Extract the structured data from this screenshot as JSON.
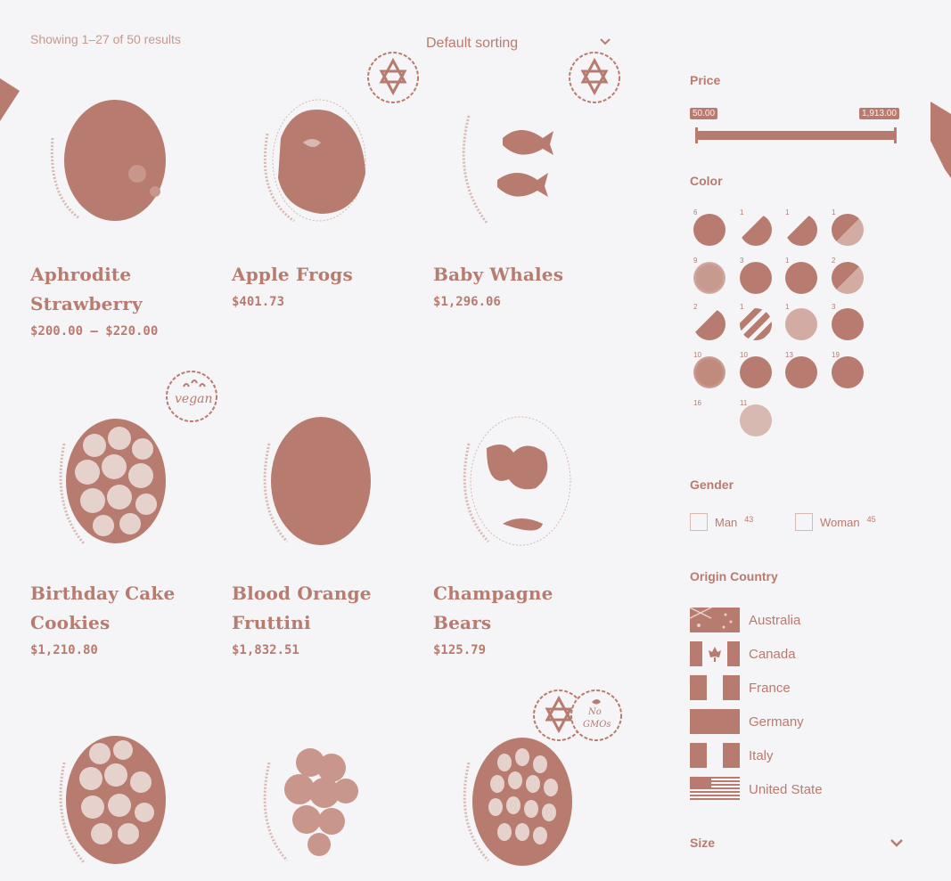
{
  "toolbar": {
    "result_count": "Showing 1–27 of 50 results",
    "sorting_label": "Default sorting"
  },
  "products": [
    {
      "title": "Aphrodite Strawberry",
      "price": "$200.00 – $220.00",
      "image": "chocolate-egg"
    },
    {
      "title": "Apple Frogs",
      "price": "$401.73",
      "image": "jelly-frogs-egg",
      "badges": [
        "kosher"
      ]
    },
    {
      "title": "Baby Whales",
      "price": "$1,296.06",
      "image": "whale-gummies-egg",
      "badges": [
        "kosher"
      ]
    },
    {
      "title": "Birthday Cake Cookies",
      "price": "$1,210.80",
      "image": "round-cookies-egg",
      "badges": [
        "vegan"
      ]
    },
    {
      "title": "Blood Orange Fruttini",
      "price": "$1,832.51",
      "image": "orange-fruttini-egg"
    },
    {
      "title": "Champagne Bears",
      "price": "$125.79",
      "image": "bears-egg"
    },
    {
      "title": "",
      "price": "",
      "image": "cookie-balls-egg"
    },
    {
      "title": "",
      "price": "",
      "image": "gummy-cluster-egg"
    },
    {
      "title": "",
      "price": "",
      "image": "dragee-egg",
      "badges": [
        "kosher",
        "no-gmo"
      ]
    }
  ],
  "badge_text": {
    "vegan": "vegan",
    "no_gmo_line1": "No",
    "no_gmo_line2": "GMOs"
  },
  "sidebar": {
    "price": {
      "title": "Price",
      "min_label": "50.00",
      "max_label": "1,913.00"
    },
    "color": {
      "title": "Color",
      "swatches": [
        {
          "count": "6",
          "color": "#b77c6f",
          "style": "solid"
        },
        {
          "count": "1",
          "color": "#b77c6f",
          "style": "half"
        },
        {
          "count": "1",
          "color": "#b77c6f",
          "style": "half"
        },
        {
          "count": "1",
          "color": "#b77c6f",
          "style": "split"
        },
        {
          "count": "9",
          "color": "#c79a8f",
          "style": "dotted"
        },
        {
          "count": "3",
          "color": "#b77c6f",
          "style": "solid"
        },
        {
          "count": "1",
          "color": "#b77c6f",
          "style": "solid"
        },
        {
          "count": "2",
          "color": "#b77c6f",
          "style": "split"
        },
        {
          "count": "2",
          "color": "#b77c6f",
          "style": "half"
        },
        {
          "count": "1",
          "color": "#b77c6f",
          "style": "stripes"
        },
        {
          "count": "1",
          "color": "#d2aba2",
          "style": "light"
        },
        {
          "count": "3",
          "color": "#b77c6f",
          "style": "solid"
        },
        {
          "count": "10",
          "color": "#c08a7d",
          "style": "dotted"
        },
        {
          "count": "10",
          "color": "#b77c6f",
          "style": "solid"
        },
        {
          "count": "13",
          "color": "#b77c6f",
          "style": "solid"
        },
        {
          "count": "19",
          "color": "#b77c6f",
          "style": "solid"
        },
        {
          "count": "16",
          "color": "#f5f4f6",
          "style": "empty"
        },
        {
          "count": "11",
          "color": "#d8b9b2",
          "style": "light"
        }
      ]
    },
    "gender": {
      "title": "Gender",
      "options": [
        {
          "label": "Man",
          "count": "43"
        },
        {
          "label": "Woman",
          "count": "45"
        }
      ]
    },
    "origin": {
      "title": "Origin Country",
      "countries": [
        {
          "name": "Australia",
          "flag": "australia"
        },
        {
          "name": "Canada",
          "flag": "canada"
        },
        {
          "name": "France",
          "flag": "france"
        },
        {
          "name": "Germany",
          "flag": "germany"
        },
        {
          "name": "Italy",
          "flag": "italy"
        },
        {
          "name": "United State",
          "flag": "usa"
        }
      ]
    },
    "size": {
      "title": "Size"
    }
  },
  "colors": {
    "accent": "#b77c6f",
    "background": "#f5f4f6",
    "muted": "#c49a90"
  }
}
